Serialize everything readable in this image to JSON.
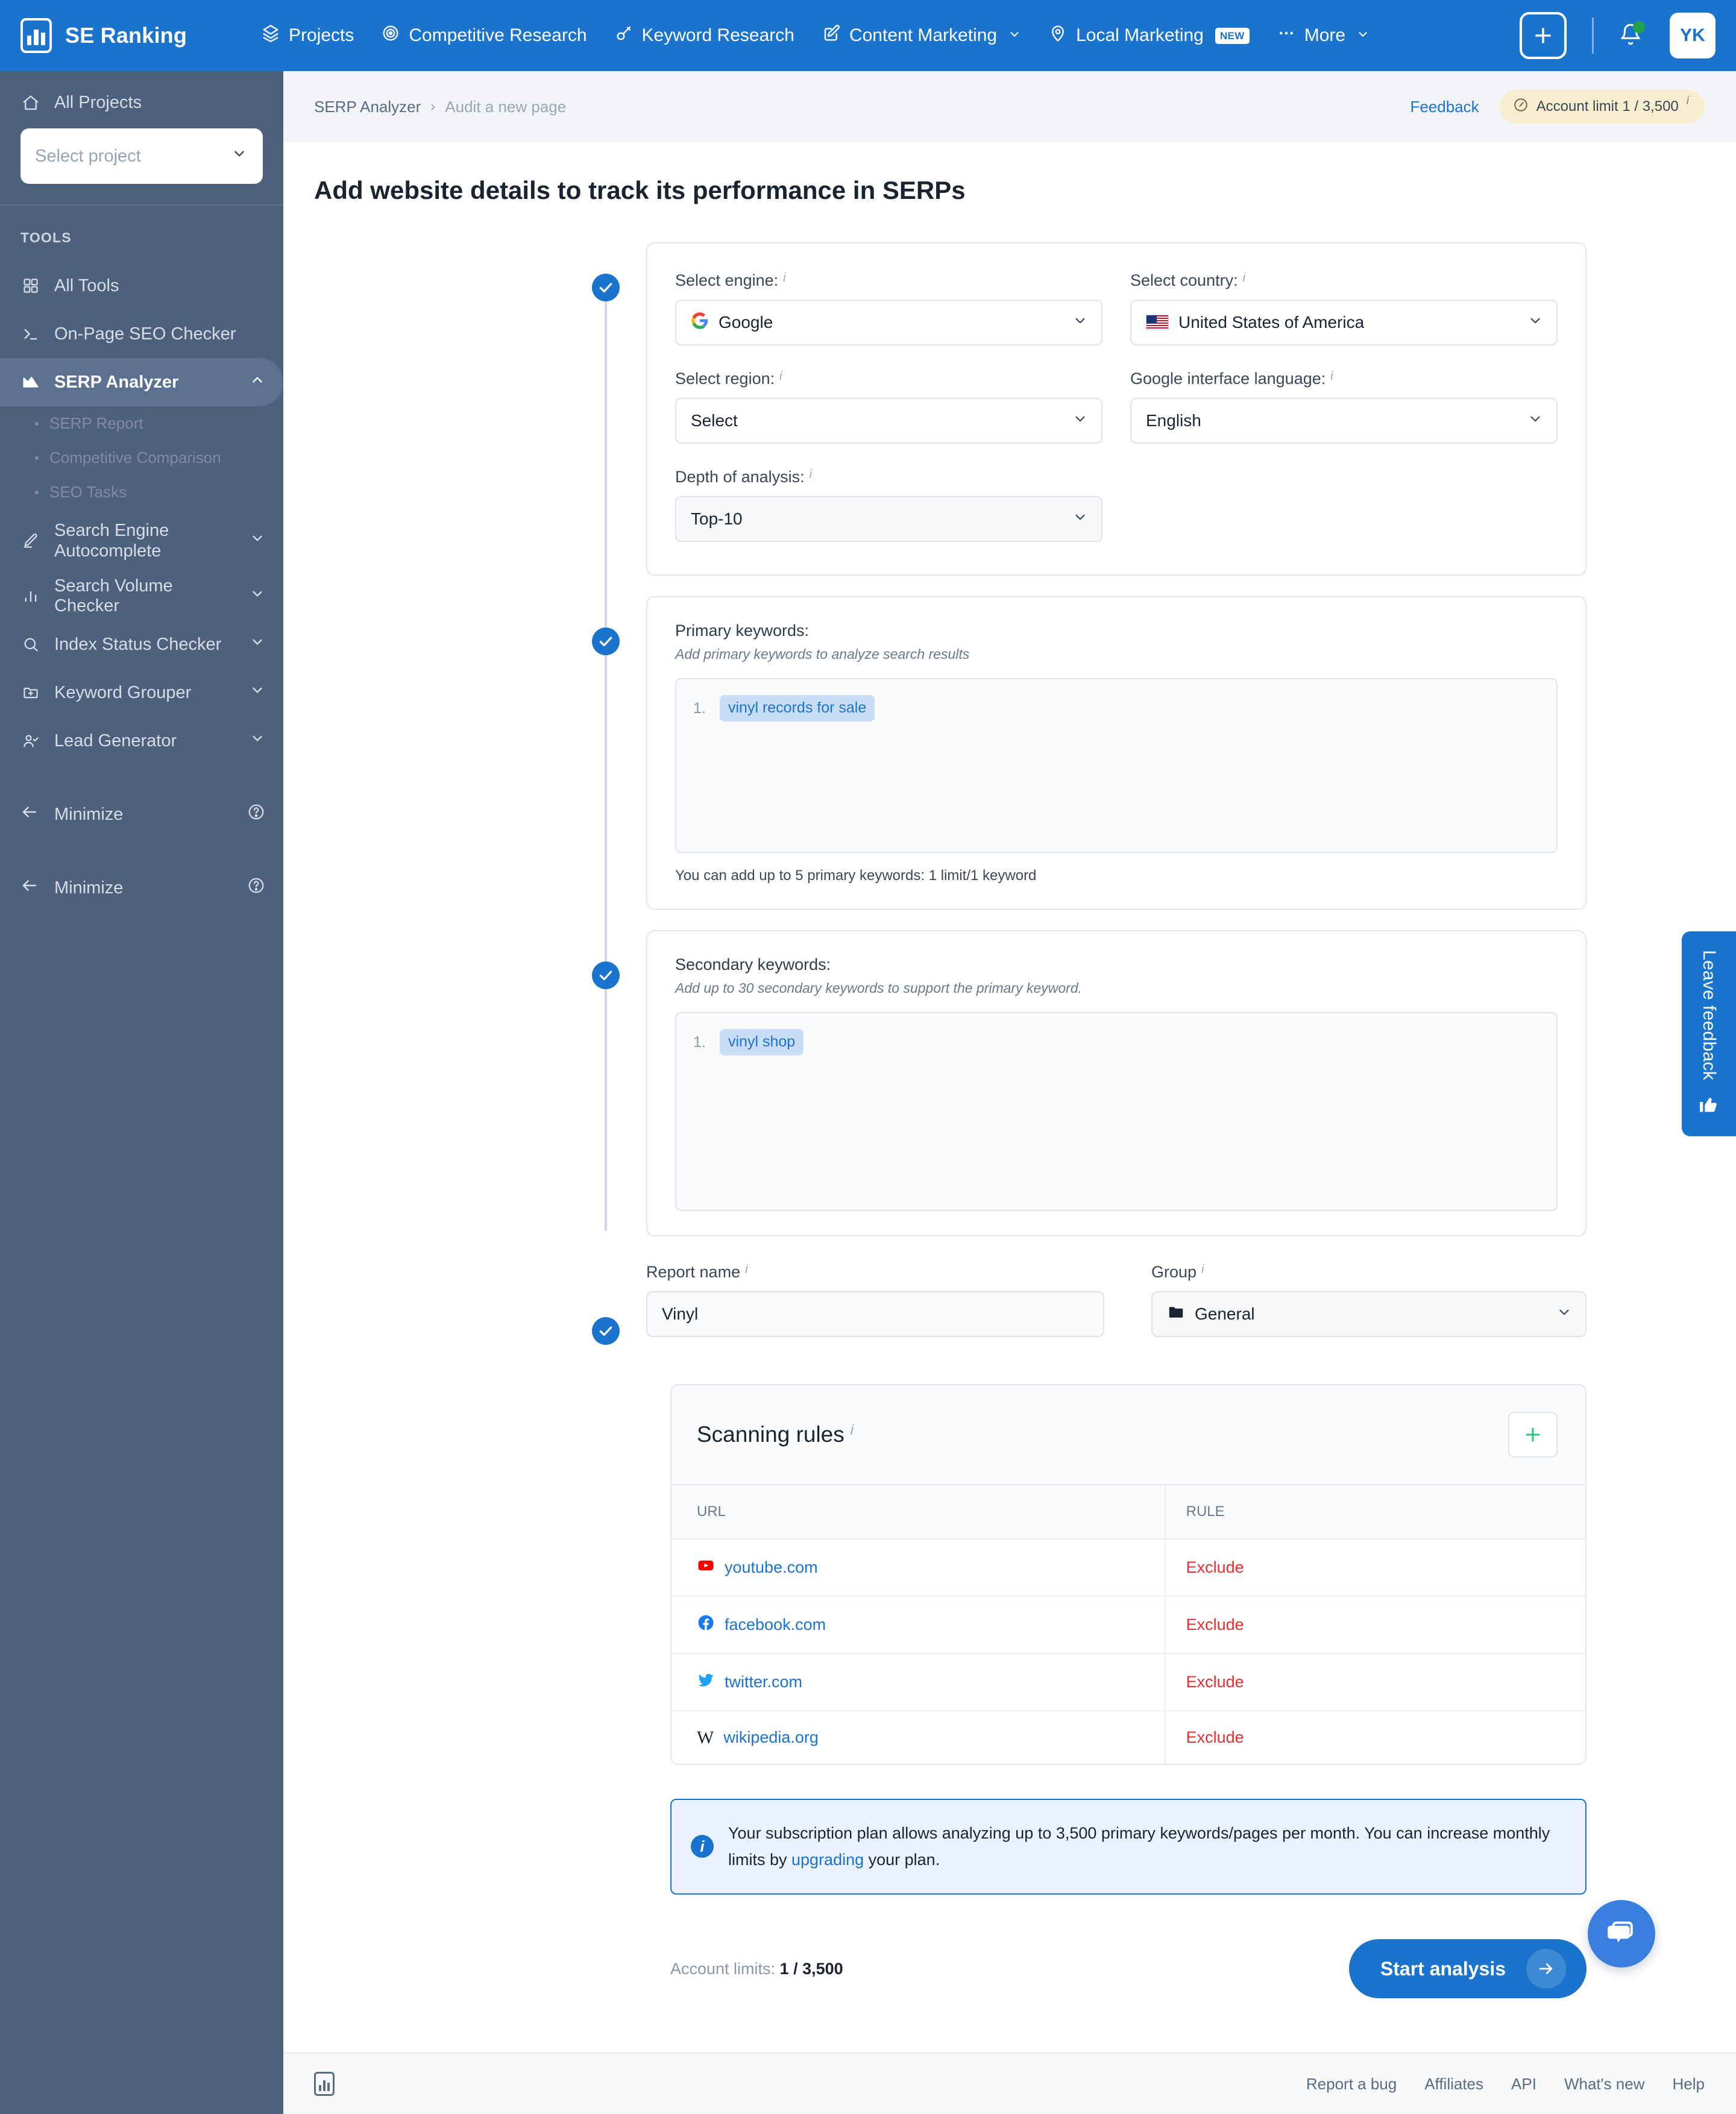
{
  "topnav": {
    "brand": "SE Ranking",
    "items": [
      {
        "label": "Projects",
        "icon": "layers-icon",
        "caret": false,
        "badge": ""
      },
      {
        "label": "Competitive Research",
        "icon": "target-icon",
        "caret": false,
        "badge": ""
      },
      {
        "label": "Keyword Research",
        "icon": "key-icon",
        "caret": false,
        "badge": ""
      },
      {
        "label": "Content Marketing",
        "icon": "edit-square-icon",
        "caret": true,
        "badge": ""
      },
      {
        "label": "Local Marketing",
        "icon": "map-pin-icon",
        "caret": false,
        "badge": "NEW"
      },
      {
        "label": "More",
        "icon": "ellipsis-icon",
        "caret": true,
        "badge": ""
      }
    ],
    "add_button": "+",
    "avatar_initials": "YK"
  },
  "sidebar": {
    "all_projects": "All Projects",
    "project_placeholder": "Select project",
    "tools_label": "TOOLS",
    "items": [
      {
        "label": "All Tools",
        "icon": "grid-icon",
        "caret": false
      },
      {
        "label": "On-Page SEO Checker",
        "icon": "terminal-icon",
        "caret": false
      },
      {
        "label": "SERP Analyzer",
        "icon": "serp-icon",
        "caret": true,
        "active": true
      },
      {
        "label": "Search Engine Autocomplete",
        "icon": "pencil-icon",
        "caret": true
      },
      {
        "label": "Search Volume Checker",
        "icon": "bars-icon",
        "caret": true
      },
      {
        "label": "Index Status Checker",
        "icon": "search-icon",
        "caret": true
      },
      {
        "label": "Keyword Grouper",
        "icon": "folder-plus-icon",
        "caret": true
      },
      {
        "label": "Lead Generator",
        "icon": "user-check-icon",
        "caret": true
      }
    ],
    "sub_items": [
      "SERP Report",
      "Competitive Comparison",
      "SEO Tasks"
    ],
    "minimize_1": "Minimize",
    "minimize_2": "Minimize"
  },
  "breadcrumb": {
    "parent": "SERP Analyzer",
    "separator": "›",
    "current": "Audit a new page",
    "feedback": "Feedback",
    "account_limit": "Account limit 1 / 3,500"
  },
  "page": {
    "title": "Add website details to track its performance in SERPs"
  },
  "engine_card": {
    "engine_label": "Select engine:",
    "engine_value": "Google",
    "country_label": "Select country:",
    "country_value": "United States of America",
    "region_label": "Select region:",
    "region_value": "Select",
    "language_label": "Google interface language:",
    "language_value": "English",
    "depth_label": "Depth of analysis:",
    "depth_value": "Top-10"
  },
  "primary": {
    "title": "Primary keywords:",
    "subtitle": "Add primary keywords to analyze search results",
    "keywords": [
      {
        "num": "1.",
        "text": "vinyl records for sale"
      }
    ],
    "footnote": "You can add up to 5 primary keywords: 1 limit/1 keyword"
  },
  "secondary": {
    "title": "Secondary keywords:",
    "subtitle": "Add up to 30 secondary keywords to support the primary keyword.",
    "keywords": [
      {
        "num": "1.",
        "text": "vinyl shop"
      }
    ]
  },
  "report": {
    "name_label": "Report name",
    "name_value": "Vinyl",
    "group_label": "Group",
    "group_value": "General"
  },
  "scanning_rules": {
    "title": "Scanning rules",
    "add_label": "+",
    "columns": [
      "URL",
      "RULE"
    ],
    "rows": [
      {
        "url": "youtube.com",
        "icon": "youtube-icon",
        "rule": "Exclude"
      },
      {
        "url": "facebook.com",
        "icon": "facebook-icon",
        "rule": "Exclude"
      },
      {
        "url": "twitter.com",
        "icon": "twitter-icon",
        "rule": "Exclude"
      },
      {
        "url": "wikipedia.org",
        "icon": "wikipedia-icon",
        "rule": "Exclude"
      }
    ]
  },
  "notice": {
    "text_before": "Your subscription plan allows analyzing up to 3,500 primary keywords/pages per month. You can increase monthly limits by ",
    "link": "upgrading",
    "text_after": " your plan."
  },
  "actions": {
    "account_limits_label": "Account limits:",
    "account_limits_value": "1 / 3,500",
    "start_button": "Start analysis"
  },
  "footer": {
    "links": [
      "Report a bug",
      "Affiliates",
      "API",
      "What's new",
      "Help"
    ]
  },
  "floating": {
    "feedback_tab": "Leave feedback",
    "chat": "chat-icon"
  },
  "colors": {
    "brand_blue": "#1a73cc",
    "sidebar": "#4e617c",
    "exclude_red": "#e23030",
    "accent_green": "#21a24a"
  }
}
